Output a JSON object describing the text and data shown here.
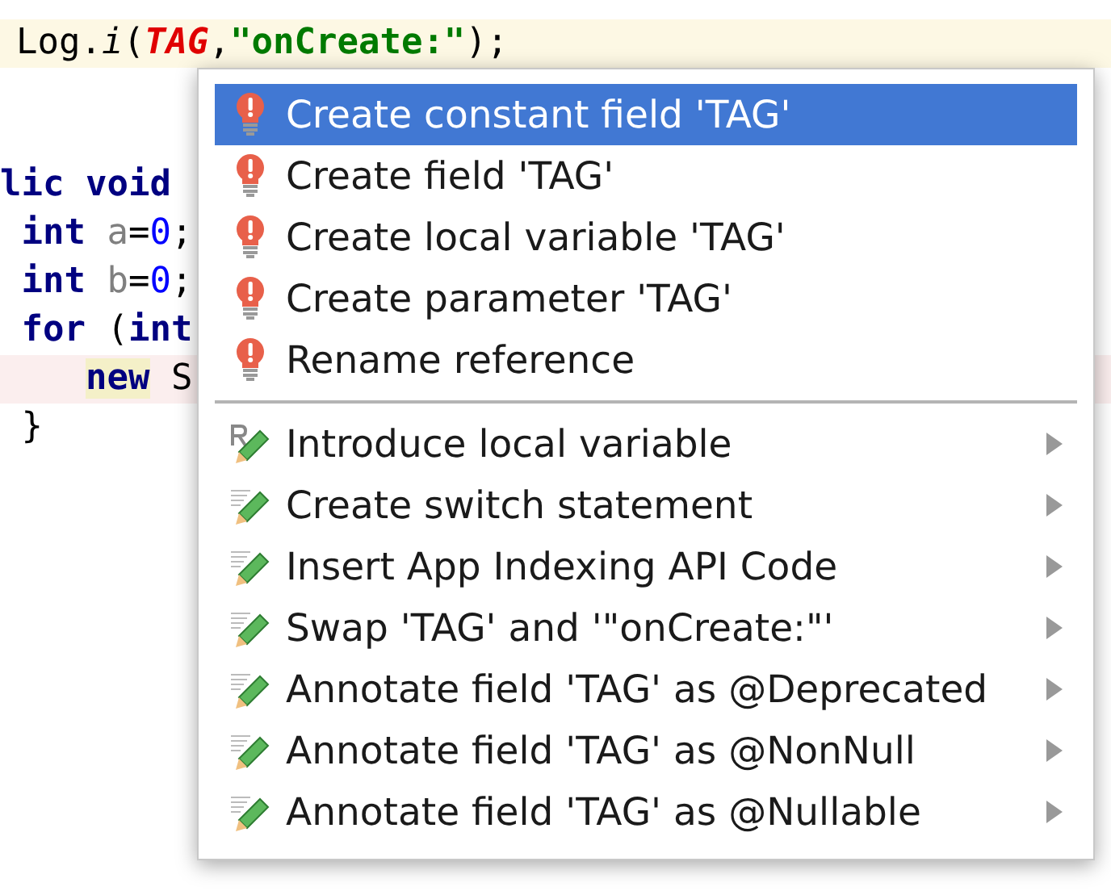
{
  "editor": {
    "current_line": {
      "tokens": [
        {
          "text": "Log.",
          "kind": "plain"
        },
        {
          "text": "i",
          "kind": "method"
        },
        {
          "text": "(",
          "kind": "plain"
        },
        {
          "text": "TAG",
          "kind": "constant"
        },
        {
          "text": ",",
          "kind": "plain"
        },
        {
          "text": "\"onCreate:\"",
          "kind": "string"
        },
        {
          "text": ");",
          "kind": "plain"
        }
      ]
    },
    "lines": [
      {
        "highlighted": false,
        "tokens": [
          {
            "text": "lic void",
            "kind": "keyword"
          }
        ]
      },
      {
        "highlighted": false,
        "tokens": [
          {
            "text": " int",
            "kind": "keyword"
          },
          {
            "text": " a",
            "kind": "variable"
          },
          {
            "text": "=",
            "kind": "plain"
          },
          {
            "text": "0",
            "kind": "number"
          },
          {
            "text": ";",
            "kind": "plain"
          }
        ]
      },
      {
        "highlighted": false,
        "tokens": [
          {
            "text": " int",
            "kind": "keyword"
          },
          {
            "text": " b",
            "kind": "variable"
          },
          {
            "text": "=",
            "kind": "plain"
          },
          {
            "text": "0",
            "kind": "number"
          },
          {
            "text": ";",
            "kind": "plain"
          }
        ]
      },
      {
        "highlighted": false,
        "tokens": [
          {
            "text": " for",
            "kind": "keyword"
          },
          {
            "text": " (",
            "kind": "plain"
          },
          {
            "text": "int",
            "kind": "keyword"
          }
        ]
      },
      {
        "highlighted": true,
        "tokens": [
          {
            "text": "    new",
            "kind": "keyword_marked"
          },
          {
            "text": " S",
            "kind": "plain"
          }
        ]
      },
      {
        "highlighted": false,
        "tokens": [
          {
            "text": " }",
            "kind": "plain"
          }
        ]
      }
    ]
  },
  "menu": {
    "sections": [
      {
        "items": [
          {
            "kind": "quickfix",
            "label": "Create constant field 'TAG'",
            "selected": true,
            "has_submenu": false
          },
          {
            "kind": "quickfix",
            "label": "Create field 'TAG'",
            "selected": false,
            "has_submenu": false
          },
          {
            "kind": "quickfix",
            "label": "Create local variable 'TAG'",
            "selected": false,
            "has_submenu": false
          },
          {
            "kind": "quickfix",
            "label": "Create parameter 'TAG'",
            "selected": false,
            "has_submenu": false
          },
          {
            "kind": "quickfix",
            "label": "Rename reference",
            "selected": false,
            "has_submenu": false
          }
        ]
      },
      {
        "items": [
          {
            "kind": "refactor",
            "label": "Introduce local variable",
            "selected": false,
            "has_submenu": true
          },
          {
            "kind": "intention",
            "label": "Create switch statement",
            "selected": false,
            "has_submenu": true
          },
          {
            "kind": "intention",
            "label": "Insert App Indexing API Code",
            "selected": false,
            "has_submenu": true
          },
          {
            "kind": "intention",
            "label": "Swap 'TAG' and '\"onCreate:\"'",
            "selected": false,
            "has_submenu": true
          },
          {
            "kind": "intention",
            "label": "Annotate field 'TAG' as @Deprecated",
            "selected": false,
            "has_submenu": true
          },
          {
            "kind": "intention",
            "label": "Annotate field 'TAG' as @NonNull",
            "selected": false,
            "has_submenu": true
          },
          {
            "kind": "intention",
            "label": "Annotate field 'TAG' as @Nullable",
            "selected": false,
            "has_submenu": true
          }
        ]
      }
    ]
  }
}
